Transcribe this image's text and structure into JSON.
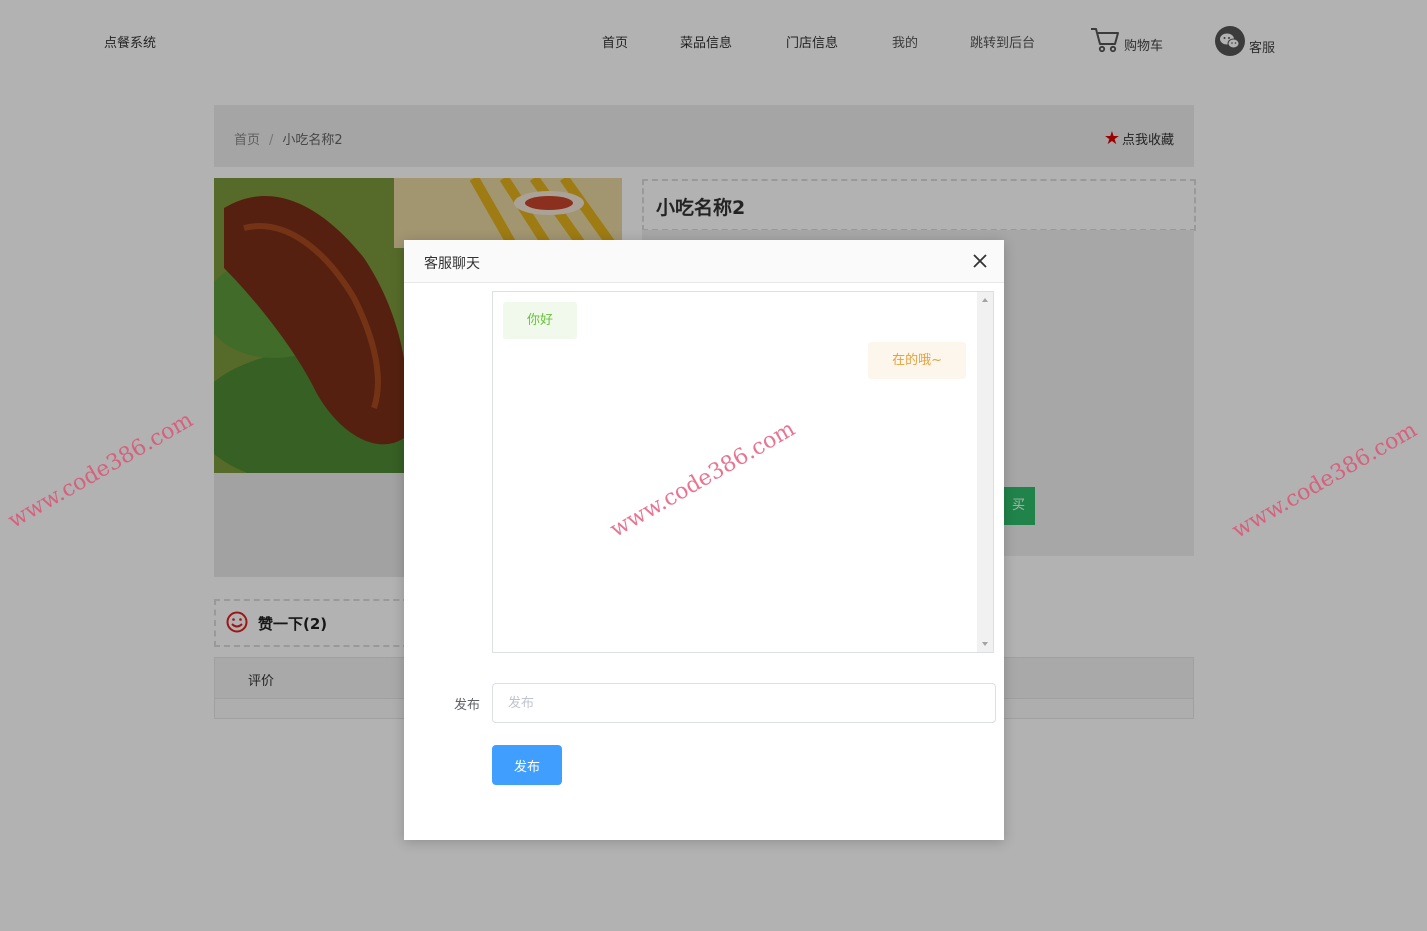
{
  "header": {
    "logo": "点餐系统",
    "nav": [
      "首页",
      "菜品信息",
      "门店信息",
      "我的",
      "跳转到后台"
    ],
    "cart_label": "购物车",
    "service_label": "客服"
  },
  "breadcrumb": {
    "home": "首页",
    "separator": "/",
    "current": "小吃名称2"
  },
  "collect_label": "点我收藏",
  "product": {
    "name": "小吃名称2",
    "buy_label_partial": "买"
  },
  "like": {
    "label": "赞一下(2)"
  },
  "review": {
    "tab_label": "评价"
  },
  "dialog": {
    "title": "客服聊天",
    "messages": [
      {
        "side": "left",
        "text": "你好"
      },
      {
        "side": "right",
        "text": "在的哦~"
      }
    ],
    "form_label": "发布",
    "input_placeholder": "发布",
    "input_value": "",
    "submit_label": "发布"
  },
  "watermark": "www.code386.com",
  "colors": {
    "accent": "#409eff",
    "buy_green": "#2fbe6a",
    "star_red": "#e00000",
    "msg_left_bg": "#f0f9eb",
    "msg_left_text": "#67c23a",
    "msg_right_bg": "#fdf6ec",
    "msg_right_text": "#e6a23c"
  }
}
